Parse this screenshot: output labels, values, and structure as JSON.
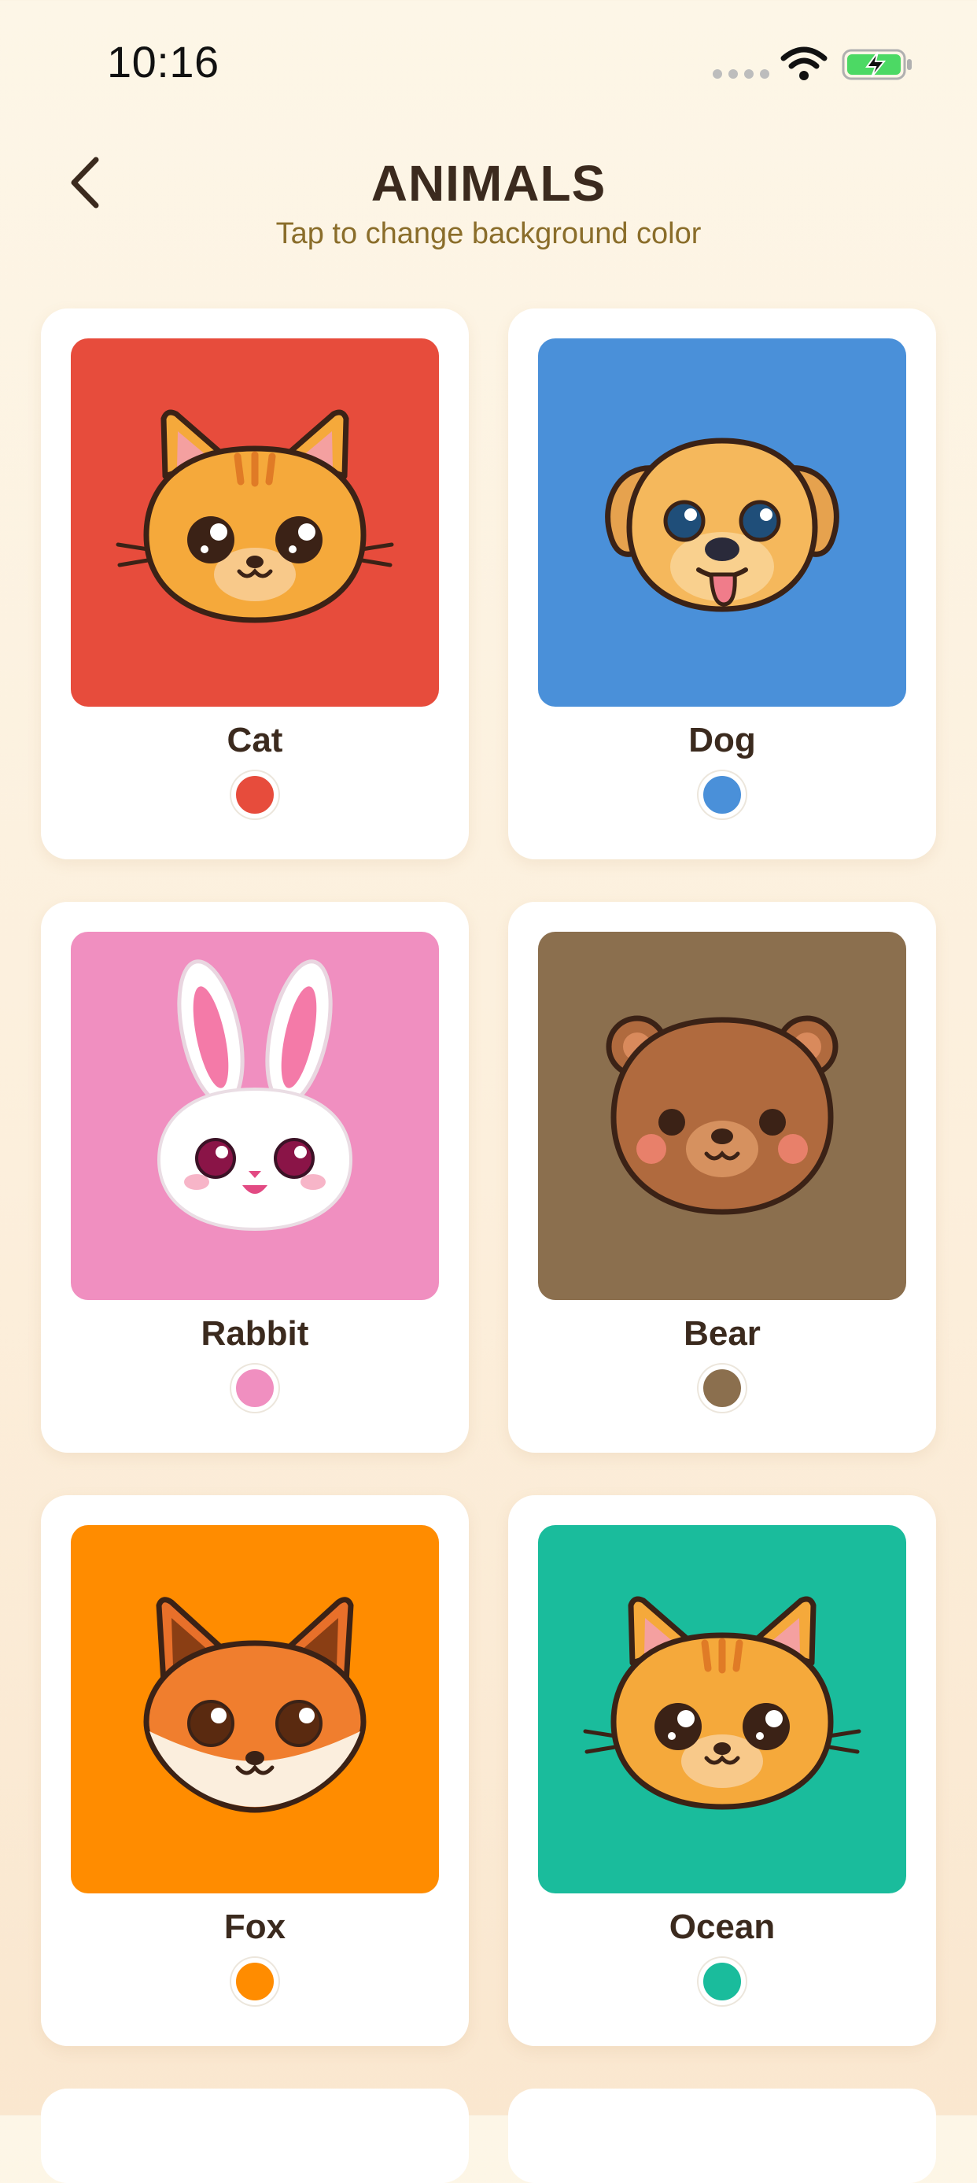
{
  "status_bar": {
    "time": "10:16"
  },
  "header": {
    "title": "ANIMALS",
    "subtitle": "Tap to change background color"
  },
  "cards": [
    {
      "label": "Cat",
      "color": "#e74c3c",
      "icon": "cat-face-icon"
    },
    {
      "label": "Dog",
      "color": "#4a90d9",
      "icon": "dog-face-icon"
    },
    {
      "label": "Rabbit",
      "color": "#f08fc0",
      "icon": "rabbit-face-icon"
    },
    {
      "label": "Bear",
      "color": "#8b6f4e",
      "icon": "bear-face-icon"
    },
    {
      "label": "Fox",
      "color": "#ff8c00",
      "icon": "fox-face-icon"
    },
    {
      "label": "Ocean",
      "color": "#1abc9c",
      "icon": "cat-face-icon"
    }
  ]
}
